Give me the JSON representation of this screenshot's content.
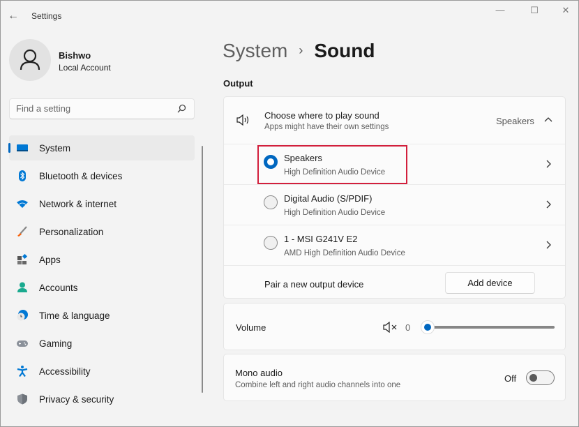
{
  "window": {
    "title": "Settings",
    "controls": {
      "minimize": "—",
      "maximize": "☐",
      "close": "✕"
    }
  },
  "profile": {
    "name": "Bishwo",
    "account_type": "Local Account"
  },
  "search": {
    "placeholder": "Find a setting",
    "value": ""
  },
  "sidebar": {
    "items": [
      {
        "label": "System",
        "icon": "system-icon",
        "active": true
      },
      {
        "label": "Bluetooth & devices",
        "icon": "bluetooth-icon"
      },
      {
        "label": "Network & internet",
        "icon": "wifi-icon"
      },
      {
        "label": "Personalization",
        "icon": "brush-icon"
      },
      {
        "label": "Apps",
        "icon": "apps-icon"
      },
      {
        "label": "Accounts",
        "icon": "accounts-icon"
      },
      {
        "label": "Time & language",
        "icon": "time-language-icon"
      },
      {
        "label": "Gaming",
        "icon": "gaming-icon"
      },
      {
        "label": "Accessibility",
        "icon": "accessibility-icon"
      },
      {
        "label": "Privacy & security",
        "icon": "shield-icon"
      }
    ]
  },
  "breadcrumb": {
    "parent": "System",
    "separator": "›",
    "current": "Sound"
  },
  "output": {
    "section_label": "Output",
    "chooser": {
      "title": "Choose where to play sound",
      "subtitle": "Apps might have their own settings",
      "selected_value": "Speakers",
      "expanded": true
    },
    "devices": [
      {
        "name": "Speakers",
        "description": "High Definition Audio Device",
        "selected": true
      },
      {
        "name": "Digital Audio (S/PDIF)",
        "description": "High Definition Audio Device",
        "selected": false
      },
      {
        "name": "1 - MSI G241V E2",
        "description": "AMD High Definition Audio Device",
        "selected": false
      }
    ],
    "pair": {
      "label": "Pair a new output device",
      "button": "Add device"
    },
    "volume": {
      "label": "Volume",
      "value": "0",
      "percent": 0,
      "muted": true
    },
    "mono": {
      "title": "Mono audio",
      "subtitle": "Combine left and right audio channels into one",
      "state_label": "Off",
      "on": false
    }
  },
  "colors": {
    "accent": "#0067c0",
    "highlight": "#d21f3c",
    "background": "#f3f3f3",
    "card": "#fbfbfb"
  }
}
